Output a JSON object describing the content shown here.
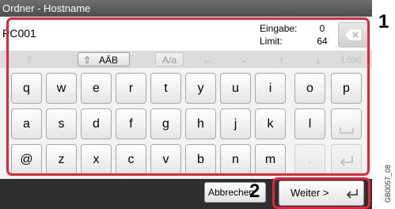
{
  "title": "Ordner - Hostname",
  "input": {
    "value": "PC001"
  },
  "counter": {
    "input_label": "Eingabe:",
    "input_value": "0",
    "limit_label": "Limit:",
    "limit_value": "64"
  },
  "toolbar": {
    "shift_glyph": "⇧",
    "charset_label": "AÄB",
    "case_label": "A/a",
    "left": "←",
    "right": "→",
    "up": "↑",
    "down": "↓",
    "delete_label": "Lösc"
  },
  "keys": {
    "row1": [
      "q",
      "w",
      "e",
      "r",
      "t",
      "y",
      "u",
      "i",
      "o",
      "p"
    ],
    "row2": [
      "a",
      "s",
      "d",
      "f",
      "g",
      "h",
      "j",
      "k",
      "l"
    ],
    "row3": [
      "@",
      "z",
      "x",
      "c",
      "v",
      "b",
      "n",
      "m",
      "."
    ]
  },
  "buttons": {
    "back": "Abbrechen",
    "next": "Weiter >"
  },
  "callouts": {
    "one": "1",
    "two": "2"
  },
  "figure_ref": "GB0057_08"
}
